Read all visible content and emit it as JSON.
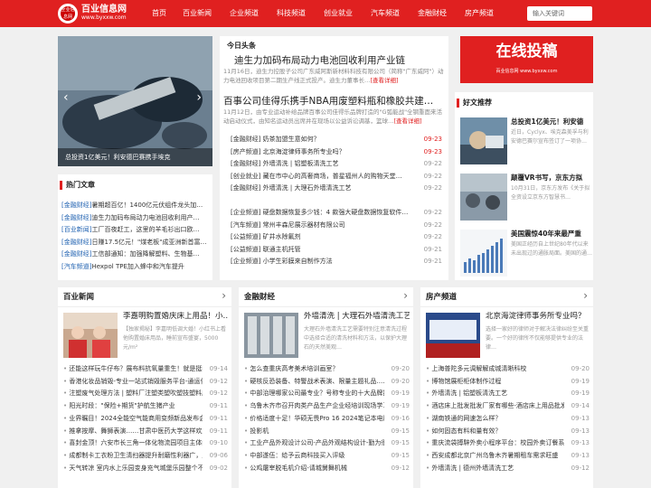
{
  "site": {
    "logo_text": "全业信息网",
    "name": "百业信息网",
    "url": "www.byxxw.com"
  },
  "nav": [
    "首页",
    "百业新闻",
    "企业频道",
    "科技频道",
    "创业就业",
    "汽车频道",
    "金融财经",
    "房产频道"
  ],
  "search_placeholder": "输入关键词",
  "slide": {
    "caption": "总投资1亿美元！利安德巴赛携手埃克"
  },
  "hot": {
    "title": "热门文章",
    "items": [
      {
        "tag": "[金融财经]",
        "text": "暑期超百亿！1400亿元伏组件龙头加…"
      },
      {
        "tag": "[金融财经]",
        "text": "迪生力加码布局动力电池回收利用产…"
      },
      {
        "tag": "[百业新闻]",
        "text": "工厂百夜赶工，这里的羊毛衫出口欧…"
      },
      {
        "tag": "[金融财经]",
        "text": "日赚17.5亿元！\"煤老板\"成亚洲新首富…"
      },
      {
        "tag": "[金融财经]",
        "text": "工信部通知：加强降解塑料、生物基…"
      },
      {
        "tag": "[汽车频道]",
        "text": "Hexpol TPE加入蜂中和汽车提升"
      }
    ]
  },
  "headlines": {
    "title": "今日头条",
    "items": [
      {
        "title": "迪生力加码布局动力电池回收利用产业链",
        "summary": "11月16日，迪生力控股子公司广东威阿斯新材料科技有限公司（简称\"广东威阿\"）动力电池回收项目第二期生产线正式投产。迪生力董事长…",
        "more": "[查看详细]"
      },
      {
        "title": "百事公司佳得乐携手NBA用废塑料瓶和橡胶共建…",
        "summary": "11月12日，由专业运动补给品牌百事公司佳得乐品牌打造的\"G弧能战\"全钢重面来活动启动仪式，由知名运动员出席并在现场以公益诉讼调基，篮球…",
        "more": "[查看详细]"
      }
    ],
    "list1": [
      {
        "t": "[金融财经] 奶茶加盟生意如何？",
        "d": "09-23",
        "red": true
      },
      {
        "t": "[房产频道] 北京海淀律师事务所专业吗？",
        "d": "09-23",
        "red": true
      },
      {
        "t": "[金融财经] 外墙清洗 | 铝塑板清洗工艺",
        "d": "09-22",
        "red": false
      },
      {
        "t": "[创业就业] 藏在市中心的高奢商场，普星福州人的购物天堂…",
        "d": "09-22",
        "red": false
      },
      {
        "t": "[金融财经] 外墙清洗 | 大理石外墙清洗工艺",
        "d": "09-22",
        "red": false
      }
    ],
    "list2": [
      {
        "t": "[企业频道] 硬盘数据恢复多少钱：4 款强大硬盘数据恢复软件…",
        "d": "09-22"
      },
      {
        "t": "[汽车频道] 常州丰森尼展示器材有限公司",
        "d": "09-22"
      },
      {
        "t": "[公益频道] 矿井水除氟剂",
        "d": "09-22"
      },
      {
        "t": "[公益频道] 联通主机托管",
        "d": "09-21"
      },
      {
        "t": "[企业频道] 小学生彩膜来自制作方法",
        "d": "09-21"
      }
    ]
  },
  "ad": {
    "big": "在线投稿",
    "small": "百业信息网 www.byxxw.com"
  },
  "good": {
    "title": "好文推荐",
    "items": [
      {
        "title": "总投资1亿美元！利安德",
        "desc": "近日，Cyclyx、埃克森美孚与利安德巴赛尔宣布签订了一项协…"
      },
      {
        "title": "颠覆VR书写，京东方拟",
        "desc": "10月31日，京东方发布《关于拟全资设立京东方智慧书…"
      },
      {
        "title": "美国震惊40年来最严重",
        "desc": "美国正经历自上世纪80年代以来未出现过的通胀局面。美国的通…"
      }
    ]
  },
  "cols": [
    {
      "name": "百业新闻",
      "feat_t": "李嘉明购置婚庆床上用品！小…",
      "feat_d": "【独家揭秘】李嘉明低调大婚！小红书上看他购置婚床用品，睡前宣布盛宴，5000元/m²",
      "items": [
        {
          "t": "还能这样玩牛仔布？展布料抗氧量重生！就是挺搞",
          "d": "09-14"
        },
        {
          "t": "香港化妆品销毁-专业一站式销毁服务平台-通运化",
          "d": "09-12"
        },
        {
          "t": "注塑废气处理方法 | 塑料厂注塑类塑吹塑技塑料废",
          "d": "09-12"
        },
        {
          "t": "阳光时段：\"保险+期货\"护航生猪产业",
          "d": "09-11"
        },
        {
          "t": "业界瞩目！2024全能空气能商用变频新品发布会-",
          "d": "09-11"
        },
        {
          "t": "推拿按摩、舞狮表演……甘肃中医药大学这样欢度",
          "d": "09-11"
        },
        {
          "t": "喜封金顶！六安市长三角一体化物流园项目主体结",
          "d": "09-10"
        },
        {
          "t": "成都制卡工衣粉卫生清扫器提升耐磨性利器广，成都制卡公",
          "d": "09-06"
        },
        {
          "t": "天气转凉 室内水上乐园变身充气城堡乐园整个不",
          "d": "09-02"
        }
      ]
    },
    {
      "name": "金融财经",
      "feat_t": "外墙清洗 | 大理石外墙清洗工艺",
      "feat_d": "大理石外墙清洗工艺需要特别注意清洗过程中选择合适的清洗材料和方法，以保护大理石的天然美观…",
      "items": [
        {
          "t": "怎么查重庆高考美术培训画室？",
          "d": "09-20"
        },
        {
          "t": "硬核反恐装备、特警战术表演、限量主题礼品……",
          "d": "09-20"
        },
        {
          "t": "中部治理哪家公司最专业？号称专业的十大品牌排",
          "d": "09-19"
        },
        {
          "t": "乌鲁木齐市召开肉类产品生产企业经培训现场学习会",
          "d": "09-19"
        },
        {
          "t": "价格适度十足！华硕无畏Pro 16 2024笔记本电脑",
          "d": "09-16"
        },
        {
          "t": "投影机",
          "d": "09-15"
        },
        {
          "t": "工业产品外观设计公司-产品外观结构设计-勤为很",
          "d": "09-15"
        },
        {
          "t": "中部遂伍：给予云商科技买入评级",
          "d": "09-15"
        },
        {
          "t": "公鸡屠宰脱毛机介绍-请城舅舞机械",
          "d": "09-12"
        }
      ]
    },
    {
      "name": "房产频道",
      "feat_t": "北京海淀律师事务所专业吗？",
      "feat_d": "选择一家好的律师对于解决法律纠纷至关重要。一个好的律所不仅能够提供专业的法律…",
      "items": [
        {
          "t": "上海普陀多元调解解成城清晰科校",
          "d": "09-20"
        },
        {
          "t": "博物馆展柜柜体制作过程",
          "d": "09-19"
        },
        {
          "t": "外墙清洗 | 铝塑板清洗工艺",
          "d": "09-19"
        },
        {
          "t": "酒店床上批发批发厂家有哪些-酒店床上用品批发",
          "d": "09-14"
        },
        {
          "t": "湖南铁通的网速怎么样？",
          "d": "09-13"
        },
        {
          "t": "如何固态有料和量有效？",
          "d": "09-13"
        },
        {
          "t": "重庆流袋搏騂外卖小程序平台：校园外卖订餐系",
          "d": "09-13"
        },
        {
          "t": "西安成都北京广州乌鲁木齐暑期租车需求旺盛",
          "d": "09-13"
        },
        {
          "t": "外墙清洗 | 德州外墙清洗工艺",
          "d": "09-12"
        }
      ]
    }
  ],
  "colors": {
    "brand": "#e02020",
    "link": "#1e60b0"
  }
}
